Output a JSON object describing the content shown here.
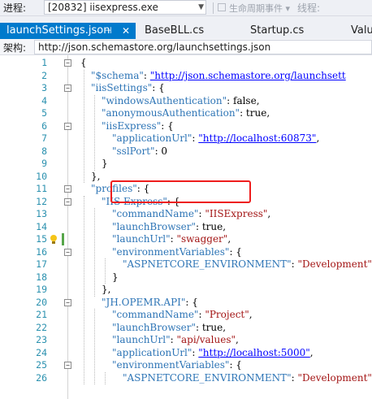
{
  "toolbar": {
    "process_label": "进程:",
    "process_value": "[20832] iisexpress.exe",
    "lifecycle_label": "生命周期事件",
    "thread_label": "线程:"
  },
  "tabs": [
    {
      "label": "launchSettings.json",
      "active": true
    },
    {
      "label": "BaseBLL.cs"
    },
    {
      "label": "Startup.cs"
    },
    {
      "label": "Value"
    }
  ],
  "schema": {
    "label": "架构:",
    "value": "http://json.schemastore.org/launchsettings.json"
  },
  "editor": {
    "line_numbers": [
      "1",
      "2",
      "3",
      "4",
      "5",
      "6",
      "7",
      "8",
      "9",
      "10",
      "11",
      "12",
      "13",
      "14",
      "15",
      "16",
      "17",
      "18",
      "19",
      "20",
      "21",
      "22",
      "23",
      "24",
      "25",
      "26"
    ],
    "lines": [
      [
        {
          "t": "{",
          "c": "punc"
        }
      ],
      [
        {
          "t": "\"$schema\"",
          "c": "key"
        },
        {
          "t": ": ",
          "c": "punc"
        },
        {
          "t": "\"http://json.schemastore.org/launchsett",
          "c": "lnk"
        }
      ],
      [
        {
          "t": "\"iisSettings\"",
          "c": "key"
        },
        {
          "t": ": {",
          "c": "punc"
        }
      ],
      [
        {
          "t": "\"windowsAuthentication\"",
          "c": "key"
        },
        {
          "t": ": false,",
          "c": "kw"
        }
      ],
      [
        {
          "t": "\"anonymousAuthentication\"",
          "c": "key"
        },
        {
          "t": ": true,",
          "c": "kw"
        }
      ],
      [
        {
          "t": "\"iisExpress\"",
          "c": "key"
        },
        {
          "t": ": {",
          "c": "punc"
        }
      ],
      [
        {
          "t": "\"applicationUrl\"",
          "c": "key"
        },
        {
          "t": ": ",
          "c": "punc"
        },
        {
          "t": "\"http://localhost:60873\"",
          "c": "lnk"
        },
        {
          "t": ",",
          "c": "punc"
        }
      ],
      [
        {
          "t": "\"sslPort\"",
          "c": "key"
        },
        {
          "t": ": 0",
          "c": "kw"
        }
      ],
      [
        {
          "t": "}",
          "c": "punc"
        }
      ],
      [
        {
          "t": "},",
          "c": "punc"
        }
      ],
      [
        {
          "t": "\"profiles\"",
          "c": "key"
        },
        {
          "t": ": {",
          "c": "punc"
        }
      ],
      [
        {
          "t": "\"IIS Express\"",
          "c": "key"
        },
        {
          "t": ": {",
          "c": "punc"
        }
      ],
      [
        {
          "t": "\"commandName\"",
          "c": "key"
        },
        {
          "t": ": ",
          "c": "punc"
        },
        {
          "t": "\"IISExpress\"",
          "c": "str"
        },
        {
          "t": ",",
          "c": "punc"
        }
      ],
      [
        {
          "t": "\"launchBrowser\"",
          "c": "key"
        },
        {
          "t": ": true,",
          "c": "kw"
        }
      ],
      [
        {
          "t": "\"launchUrl\"",
          "c": "key"
        },
        {
          "t": ": ",
          "c": "punc"
        },
        {
          "t": "\"swagger\"",
          "c": "str"
        },
        {
          "t": ",",
          "c": "punc"
        }
      ],
      [
        {
          "t": "\"environmentVariables\"",
          "c": "key"
        },
        {
          "t": ": {",
          "c": "punc"
        }
      ],
      [
        {
          "t": "\"ASPNETCORE_ENVIRONMENT\"",
          "c": "key"
        },
        {
          "t": ": ",
          "c": "punc"
        },
        {
          "t": "\"Development\"",
          "c": "str"
        }
      ],
      [
        {
          "t": "}",
          "c": "punc"
        }
      ],
      [
        {
          "t": "},",
          "c": "punc"
        }
      ],
      [
        {
          "t": "\"JH.OPEMR.API\"",
          "c": "key"
        },
        {
          "t": ": {",
          "c": "punc"
        }
      ],
      [
        {
          "t": "\"commandName\"",
          "c": "key"
        },
        {
          "t": ": ",
          "c": "punc"
        },
        {
          "t": "\"Project\"",
          "c": "str"
        },
        {
          "t": ",",
          "c": "punc"
        }
      ],
      [
        {
          "t": "\"launchBrowser\"",
          "c": "key"
        },
        {
          "t": ": true,",
          "c": "kw"
        }
      ],
      [
        {
          "t": "\"launchUrl\"",
          "c": "key"
        },
        {
          "t": ": ",
          "c": "punc"
        },
        {
          "t": "\"api/values\"",
          "c": "str"
        },
        {
          "t": ",",
          "c": "punc"
        }
      ],
      [
        {
          "t": "\"applicationUrl\"",
          "c": "key"
        },
        {
          "t": ": ",
          "c": "punc"
        },
        {
          "t": "\"http://localhost:5000\"",
          "c": "lnk"
        },
        {
          "t": ",",
          "c": "punc"
        }
      ],
      [
        {
          "t": "\"environmentVariables\"",
          "c": "key"
        },
        {
          "t": ": {",
          "c": "punc"
        }
      ],
      [
        {
          "t": "\"ASPNETCORE_ENVIRONMENT\"",
          "c": "key"
        },
        {
          "t": ": ",
          "c": "punc"
        },
        {
          "t": "\"Development\"",
          "c": "str"
        }
      ]
    ]
  },
  "colors": {
    "accent": "#007acc",
    "json_key": "#2e75b6",
    "json_string": "#a31515",
    "link": "#0000ff",
    "line_number": "#2b91af",
    "annotation": "#ee1d1d"
  }
}
